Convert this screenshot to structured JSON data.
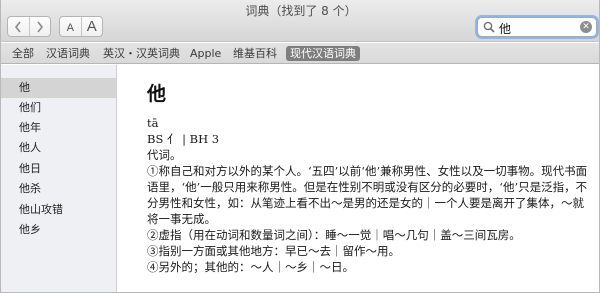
{
  "window": {
    "title": "词典（找到了 8 个）"
  },
  "toolbar": {
    "back_icon": "chevron-left-icon",
    "forward_icon": "chevron-right-icon",
    "font_small": "A",
    "font_large": "A",
    "search": {
      "value": "他",
      "icon": "search-icon",
      "clear_icon": "clear-icon"
    }
  },
  "sources": [
    {
      "label": "全部",
      "active": false
    },
    {
      "label": "汉语词典",
      "active": false
    },
    {
      "label": "英汉・汉英词典",
      "active": false
    },
    {
      "label": "Apple",
      "active": false
    },
    {
      "label": "维基百科",
      "active": false
    },
    {
      "label": "现代汉语词典",
      "active": true
    }
  ],
  "results": [
    {
      "label": "他",
      "selected": true
    },
    {
      "label": "他们",
      "selected": false
    },
    {
      "label": "他年",
      "selected": false
    },
    {
      "label": "他人",
      "selected": false
    },
    {
      "label": "他日",
      "selected": false
    },
    {
      "label": "他杀",
      "selected": false
    },
    {
      "label": "他山攻错",
      "selected": false
    },
    {
      "label": "他乡",
      "selected": false
    }
  ],
  "entry": {
    "headword": "他",
    "pinyin": "tā",
    "codes": "BS 亻 | BH 3",
    "pos": "代词。",
    "def1_l1": "①称自己和对方以外的某个人。‘五四’以前‘他’兼称男性、女性以及一切事物。现代书面",
    "def1_l2": "语里，‘他’一般只用来称男性。但是在性别不明或没有区分的必要时，‘他’只是泛指，不",
    "def1_l3": "分男性和女性，如：从笔迹上看不出～是男的还是女的｜一个人要是离开了集体，～就",
    "def1_l4": "将一事无成。",
    "def2": "②虚指（用在动词和数量词之间）：睡～一觉｜唱～几句｜盖～三间瓦房。",
    "def3": "③指别一方面或其他地方：早已～去｜留作～用。",
    "def4": "④另外的；其他的：～人｜～乡｜～日。"
  },
  "colors": {
    "selected_scope": "#7e7e7e",
    "selected_row": "#d4d4d4",
    "search_focus": "#8fb5ea"
  }
}
